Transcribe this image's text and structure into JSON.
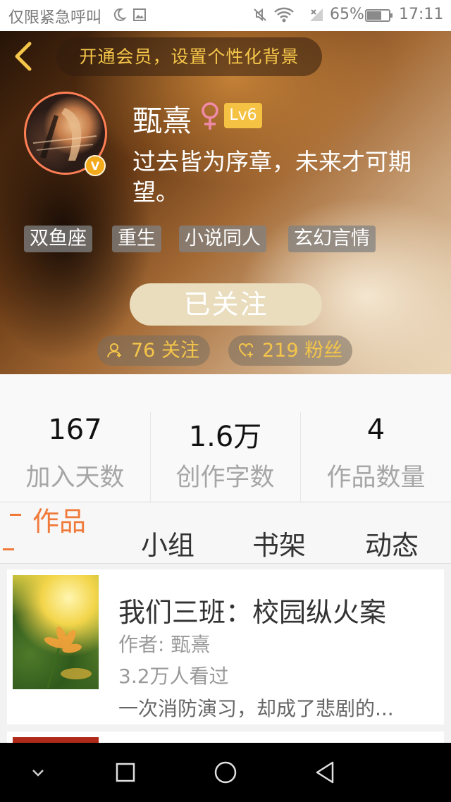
{
  "status_bar": {
    "left_text": "仅限紧急呼叫",
    "battery_percent": "65%",
    "time": "17:11"
  },
  "header": {
    "member_banner": "开通会员，设置个性化背景",
    "username": "甄熹",
    "level": "Lv6",
    "bio": "过去皆为序章，未来才可期望。",
    "tags": [
      "双鱼座",
      "重生",
      "小说同人",
      "玄幻言情"
    ],
    "follow_button": "已关注",
    "following": "76 关注",
    "followers": "219 粉丝",
    "verified_badge": "V",
    "accent_color": "#f5c64a"
  },
  "stats": [
    {
      "value": "167",
      "label": "加入天数"
    },
    {
      "value": "1.6万",
      "label": "创作字数"
    },
    {
      "value": "4",
      "label": "作品数量"
    }
  ],
  "tabs": [
    {
      "label": "作品",
      "active": true
    },
    {
      "label": "小组",
      "active": false
    },
    {
      "label": "书架",
      "active": false
    },
    {
      "label": "动态",
      "active": false
    }
  ],
  "works": [
    {
      "title": "我们三班：校园纵火案",
      "author": "作者: 甄熹",
      "views": "3.2万人看过",
      "description": "一次消防演习，却成了悲剧的..."
    }
  ],
  "icons": {
    "back": "chevron-left-icon",
    "gender": "female-icon",
    "following": "user-add-icon",
    "followers": "heart-add-icon",
    "nav": [
      "chevron-down-icon",
      "square-icon",
      "circle-icon",
      "triangle-back-icon"
    ]
  }
}
